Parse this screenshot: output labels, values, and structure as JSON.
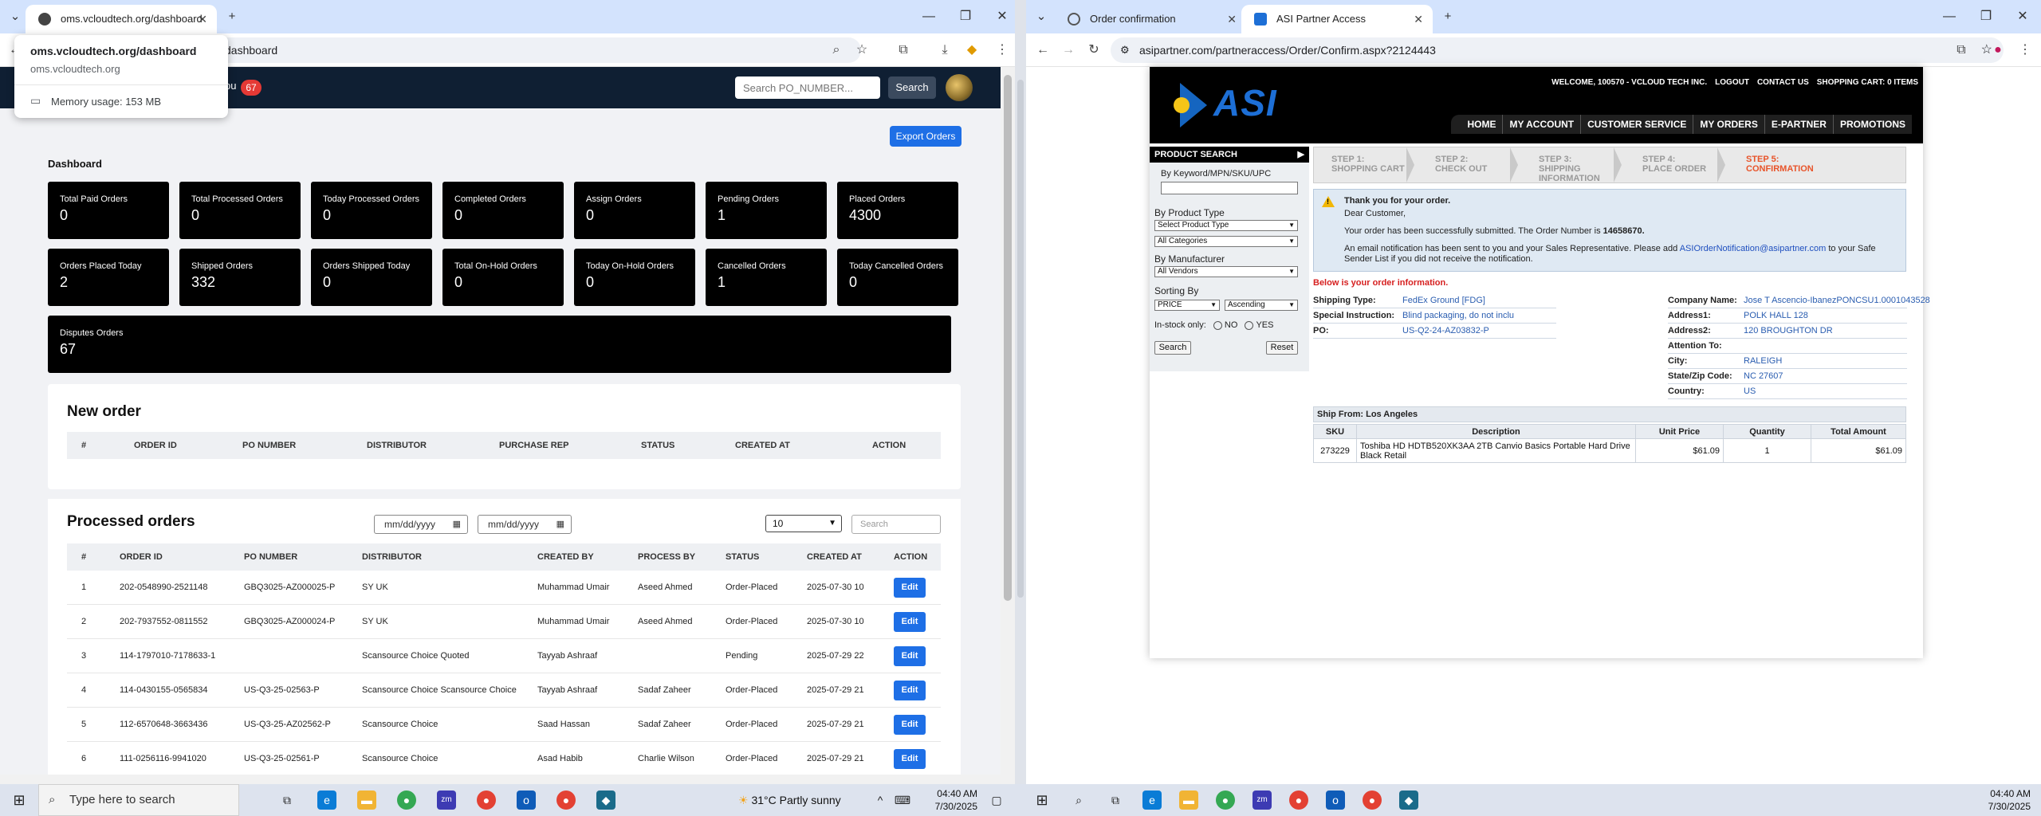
{
  "left_window": {
    "tab_title": "oms.vcloudtech.org/dashboard",
    "url_tail": "dashboard",
    "popover": {
      "title": "oms.vcloudtech.org/dashboard",
      "domain": "oms.vcloudtech.org",
      "memory": "Memory usage: 153 MB"
    },
    "nav": {
      "partial_label": "pu",
      "badge": "67",
      "search_placeholder": "Search PO_NUMBER...",
      "search_button": "Search"
    },
    "export_button": "Export Orders",
    "dashboard_title": "Dashboard",
    "cards": [
      {
        "label": "Total Paid Orders",
        "value": "0"
      },
      {
        "label": "Total Processed Orders",
        "value": "0"
      },
      {
        "label": "Today Processed Orders",
        "value": "0"
      },
      {
        "label": "Completed Orders",
        "value": "0"
      },
      {
        "label": "Assign Orders",
        "value": "0"
      },
      {
        "label": "Pending Orders",
        "value": "1"
      },
      {
        "label": "Placed Orders",
        "value": "4300"
      },
      {
        "label": "Orders Placed Today",
        "value": "2"
      },
      {
        "label": "Shipped Orders",
        "value": "332"
      },
      {
        "label": "Orders Shipped Today",
        "value": "0"
      },
      {
        "label": "Total On-Hold Orders",
        "value": "0"
      },
      {
        "label": "Today On-Hold Orders",
        "value": "0"
      },
      {
        "label": "Cancelled Orders",
        "value": "1"
      },
      {
        "label": "Today Cancelled Orders",
        "value": "0"
      }
    ],
    "disputes": {
      "label": "Disputes Orders",
      "value": "67"
    },
    "new_order": {
      "title": "New order",
      "headers": [
        "#",
        "ORDER ID",
        "PO NUMBER",
        "DISTRIBUTOR",
        "PURCHASE REP",
        "STATUS",
        "CREATED AT",
        "ACTION"
      ]
    },
    "processed": {
      "title": "Processed orders",
      "date_placeholder": "mm/dd/yyyy",
      "page_size": "10",
      "search_placeholder": "Search",
      "headers": [
        "#",
        "ORDER ID",
        "PO NUMBER",
        "DISTRIBUTOR",
        "CREATED BY",
        "PROCESS BY",
        "STATUS",
        "CREATED AT",
        "ACTION"
      ],
      "edit_label": "Edit",
      "rows": [
        [
          "1",
          "202-0548990-2521148",
          "GBQ3025-AZ000025-P",
          "SY UK",
          "Muhammad Umair",
          "Aseed Ahmed",
          "Order-Placed",
          "2025-07-30 10"
        ],
        [
          "2",
          "202-7937552-0811552",
          "GBQ3025-AZ000024-P",
          "SY UK",
          "Muhammad Umair",
          "Aseed Ahmed",
          "Order-Placed",
          "2025-07-30 10"
        ],
        [
          "3",
          "114-1797010-7178633-1",
          "",
          "Scansource Choice Quoted",
          "Tayyab Ashraaf",
          "",
          "Pending",
          "2025-07-29 22"
        ],
        [
          "4",
          "114-0430155-0565834",
          "US-Q3-25-02563-P",
          "Scansource Choice Scansource Choice",
          "Tayyab Ashraaf",
          "Sadaf Zaheer",
          "Order-Placed",
          "2025-07-29 21"
        ],
        [
          "5",
          "112-6570648-3663436",
          "US-Q3-25-AZ02562-P",
          "Scansource Choice",
          "Saad Hassan",
          "Sadaf Zaheer",
          "Order-Placed",
          "2025-07-29 21"
        ],
        [
          "6",
          "111-0256116-9941020",
          "US-Q3-25-02561-P",
          "Scansource Choice",
          "Asad Habib",
          "Charlie Wilson",
          "Order-Placed",
          "2025-07-29 21"
        ]
      ]
    }
  },
  "right_window": {
    "tabs": [
      {
        "title": "Order confirmation"
      },
      {
        "title": "ASI Partner Access"
      }
    ],
    "url": "asipartner.com/partneraccess/Order/Confirm.aspx?2124443",
    "logo": "ASI",
    "toplinks": [
      "WELCOME, 100570 - VCLOUD TECH INC.",
      "LOGOUT",
      "CONTACT US",
      "SHOPPING CART: 0 ITEMS"
    ],
    "mainnav": [
      "HOME",
      "MY ACCOUNT",
      "CUSTOMER SERVICE",
      "MY ORDERS",
      "E-PARTNER",
      "PROMOTIONS"
    ],
    "product_search": {
      "title": "PRODUCT SEARCH",
      "keyword_label": "By Keyword/MPN/SKU/UPC",
      "type_label": "By Product Type",
      "type_value": "Select Product Type",
      "category_value": "All Categories",
      "manufacturer_label": "By Manufacturer",
      "vendor_value": "All Vendors",
      "sorting_label": "Sorting By",
      "sort_field": "PRICE",
      "sort_order": "Ascending",
      "instock_label": "In-stock only:",
      "no_label": "NO",
      "yes_label": "YES",
      "search_btn": "Search",
      "reset_btn": "Reset"
    },
    "steps": [
      {
        "num": "STEP 1:",
        "name": "SHOPPING CART"
      },
      {
        "num": "STEP 2:",
        "name": "CHECK OUT"
      },
      {
        "num": "STEP 3:",
        "name": "SHIPPING INFORMATION"
      },
      {
        "num": "STEP 4:",
        "name": "PLACE ORDER"
      },
      {
        "num": "STEP 5:",
        "name": "CONFIRMATION"
      }
    ],
    "notice": {
      "thanks": "Thank you for your order.",
      "dear": "Dear Customer,",
      "submitted_prefix": "Your order has been successfully submitted. The Order Number is ",
      "order_number": "14658670.",
      "email_prefix": "An email notification has been sent to you and your Sales Representative. Please add ",
      "email": "ASIOrderNotification@asipartner.com",
      "email_suffix": " to your Safe",
      "email_line2": "Sender List if you did not receive the notification."
    },
    "below_title": "Below is your order information.",
    "info_left": [
      {
        "k": "Shipping Type:",
        "v": "FedEx Ground [FDG]"
      },
      {
        "k": "Special Instruction:",
        "v": "Blind packaging, do not inclu"
      },
      {
        "k": "PO:",
        "v": "US-Q2-24-AZ03832-P"
      }
    ],
    "info_right": [
      {
        "k": "Company Name:",
        "v": "Jose T Ascencio-IbanezPONCSU1.0001043528"
      },
      {
        "k": "Address1:",
        "v": "POLK HALL 128"
      },
      {
        "k": "Address2:",
        "v": "120 BROUGHTON DR"
      },
      {
        "k": "Attention To:",
        "v": ""
      },
      {
        "k": "City:",
        "v": "RALEIGH"
      },
      {
        "k": "State/Zip Code:",
        "v": "NC 27607"
      },
      {
        "k": "Country:",
        "v": "US"
      }
    ],
    "ship_from": "Ship From: Los Angeles",
    "order_table": {
      "headers": [
        "SKU",
        "Description",
        "Unit Price",
        "Quantity",
        "Total Amount"
      ],
      "row": {
        "sku": "273229",
        "desc1": "Toshiba HD HDTB520XK3AA 2TB Canvio Basics Portable Hard Drive",
        "desc2": "Black Retail",
        "price": "$61.09",
        "qty": "1",
        "total": "$61.09"
      }
    }
  },
  "taskbar": {
    "search_placeholder": "Type here to search",
    "weather": "31°C  Partly sunny",
    "time": "04:40 AM",
    "date": "7/30/2025"
  }
}
